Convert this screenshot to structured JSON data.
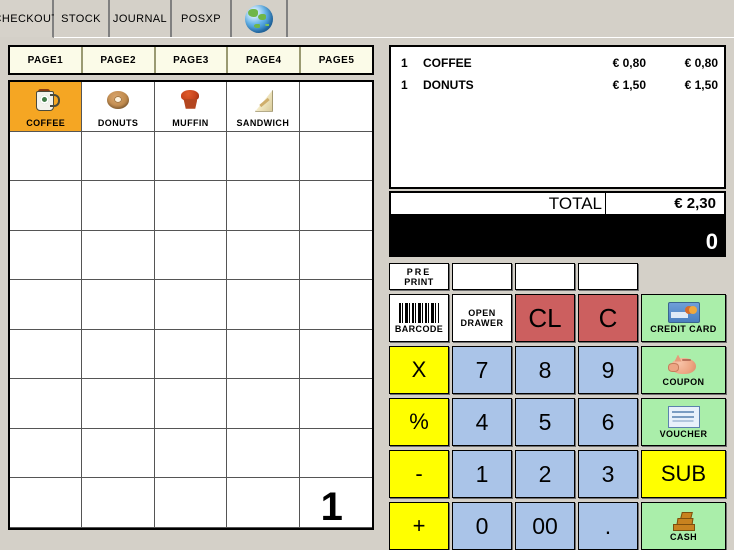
{
  "window": {
    "tabs": [
      {
        "label": "CHECKOUT",
        "active": true
      },
      {
        "label": "STOCK",
        "active": false
      },
      {
        "label": "JOURNAL",
        "active": false
      },
      {
        "label": "POSXP",
        "active": false
      },
      {
        "label": "",
        "icon": "globe-icon",
        "active": false
      }
    ]
  },
  "page_tabs": [
    {
      "label": "PAGE1"
    },
    {
      "label": "PAGE2"
    },
    {
      "label": "PAGE3"
    },
    {
      "label": "PAGE4"
    },
    {
      "label": "PAGE5"
    }
  ],
  "products": [
    {
      "label": "COFFEE",
      "icon": "coffee-cup-icon",
      "selected": true
    },
    {
      "label": "DONUTS",
      "icon": "donut-icon",
      "selected": false
    },
    {
      "label": "MUFFIN",
      "icon": "muffin-icon",
      "selected": false
    },
    {
      "label": "SANDWICH",
      "icon": "sandwich-icon",
      "selected": false
    }
  ],
  "grid": {
    "columns": 5,
    "rows": 9,
    "bottom_right_value": "1"
  },
  "receipt": {
    "items": [
      {
        "qty": "1",
        "name": "COFFEE",
        "unit_price": "€ 0,80",
        "line_total": "€ 0,80"
      },
      {
        "qty": "1",
        "name": "DONUTS",
        "unit_price": "€ 1,50",
        "line_total": "€ 1,50"
      }
    ],
    "total_label": "TOTAL",
    "total_value": "€ 2,30",
    "display_value": "0"
  },
  "keypad": {
    "row0": [
      {
        "label": "PRE",
        "label2": "PRINT",
        "name": "pre-print-button",
        "style": "blank"
      },
      {
        "label": "",
        "name": "blank-key-1",
        "style": "blank"
      },
      {
        "label": "",
        "name": "blank-key-2",
        "style": "blank"
      },
      {
        "label": "",
        "name": "blank-key-3",
        "style": "blank"
      }
    ],
    "row1": [
      {
        "label": "BARCODE",
        "name": "barcode-button",
        "icon": "barcode-icon",
        "style": "blank"
      },
      {
        "label": "OPEN",
        "label2": "DRAWER",
        "name": "open-drawer-button",
        "style": "blank"
      },
      {
        "label": "CL",
        "name": "clear-all-button",
        "style": "red"
      },
      {
        "label": "C",
        "name": "clear-button",
        "style": "red"
      },
      {
        "label": "CREDIT CARD",
        "name": "credit-card-button",
        "icon": "credit-card-icon",
        "style": "green"
      }
    ],
    "row2": [
      {
        "label": "X",
        "name": "multiply-button",
        "style": "yellow"
      },
      {
        "label": "7",
        "name": "digit-7-button",
        "style": "num"
      },
      {
        "label": "8",
        "name": "digit-8-button",
        "style": "num"
      },
      {
        "label": "9",
        "name": "digit-9-button",
        "style": "num"
      },
      {
        "label": "COUPON",
        "name": "coupon-button",
        "icon": "piggy-bank-icon",
        "style": "green"
      }
    ],
    "row3": [
      {
        "label": "%",
        "name": "percent-button",
        "style": "yellow"
      },
      {
        "label": "4",
        "name": "digit-4-button",
        "style": "num"
      },
      {
        "label": "5",
        "name": "digit-5-button",
        "style": "num"
      },
      {
        "label": "6",
        "name": "digit-6-button",
        "style": "num"
      },
      {
        "label": "VOUCHER",
        "name": "voucher-button",
        "icon": "voucher-icon",
        "style": "green"
      }
    ],
    "row4": [
      {
        "label": "-",
        "name": "minus-button",
        "style": "yellow"
      },
      {
        "label": "1",
        "name": "digit-1-button",
        "style": "num"
      },
      {
        "label": "2",
        "name": "digit-2-button",
        "style": "num"
      },
      {
        "label": "3",
        "name": "digit-3-button",
        "style": "num"
      },
      {
        "label": "SUB",
        "name": "subtotal-button",
        "style": "yellow"
      }
    ],
    "row5": [
      {
        "label": "+",
        "name": "plus-button",
        "style": "yellow"
      },
      {
        "label": "0",
        "name": "digit-0-button",
        "style": "num"
      },
      {
        "label": "00",
        "name": "digit-00-button",
        "style": "num"
      },
      {
        "label": ".",
        "name": "decimal-point-button",
        "style": "num"
      },
      {
        "label": "CASH",
        "name": "cash-button",
        "icon": "cash-icon",
        "style": "green"
      }
    ]
  },
  "colors": {
    "window_bg": "#d4d0c8",
    "selected_product": "#f5a623",
    "page_tab": "#fbfbe8",
    "num_key": "#aac4e8",
    "yellow_key": "#ffff00",
    "red_key": "#cc5f5f",
    "green_key": "#aaeeaa",
    "display_bg": "#000000"
  }
}
